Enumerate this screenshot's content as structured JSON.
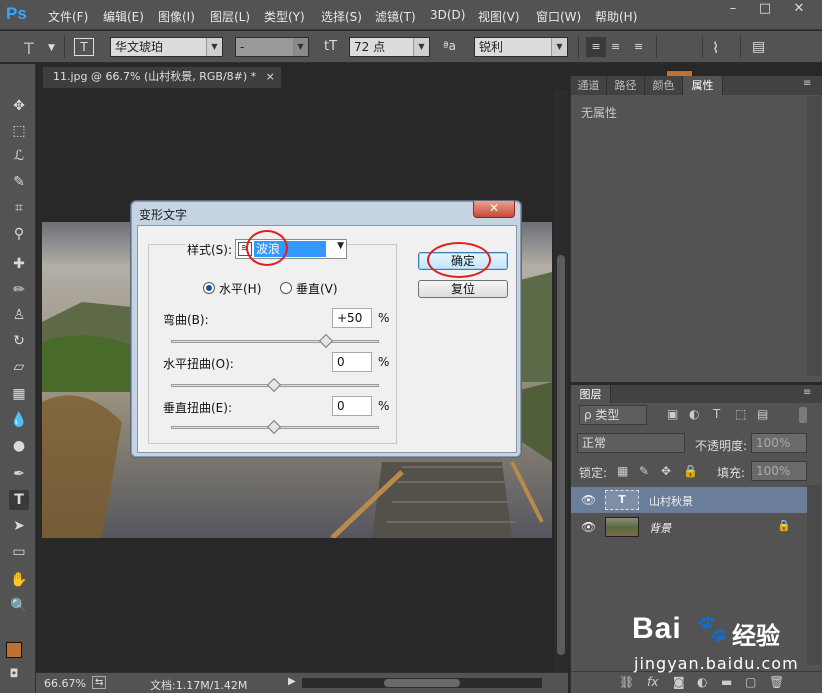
{
  "menubar": {
    "logo": "Ps",
    "items": [
      "文件(F)",
      "编辑(E)",
      "图像(I)",
      "图层(L)",
      "类型(Y)",
      "选择(S)",
      "滤镜(T)",
      "3D(D)",
      "视图(V)",
      "窗口(W)",
      "帮助(H)"
    ],
    "controls": [
      "–",
      "□",
      "✕"
    ]
  },
  "options": {
    "font_family": "华文琥珀",
    "font_style": "-",
    "font_size": "72 点",
    "aa_label": "a",
    "aa_mode": "锐利",
    "text_color": "#c07030"
  },
  "document": {
    "tab_title": "11.jpg @ 66.7% (山村秋景, RGB/8#) *",
    "tab_close": "×"
  },
  "status": {
    "zoom": "66.67%",
    "doc_info": "文档:1.17M/1.42M"
  },
  "props_panel": {
    "tabs": [
      "通道",
      "路径",
      "颜色",
      "属性"
    ],
    "active_tab": 3,
    "content": "无属性"
  },
  "layers_panel": {
    "title": "图层",
    "filter_label": "ρ 类型",
    "blend_mode": "正常",
    "opacity_label": "不透明度:",
    "opacity_value": "100%",
    "lock_label": "锁定:",
    "fill_label": "填充:",
    "fill_value": "100%",
    "layers": [
      {
        "name": "山村秋景",
        "thumb": "T",
        "selected": true
      },
      {
        "name": "背景",
        "thumb": "",
        "selected": false
      }
    ]
  },
  "dialog": {
    "title": "变形文字",
    "style_label": "样式(S):",
    "style_value": "波浪",
    "horizontal_label": "水平(H)",
    "vertical_label": "垂直(V)",
    "bend_label": "弯曲(B):",
    "bend_value": "+50",
    "h_distort_label": "水平扭曲(O):",
    "h_distort_value": "0",
    "v_distort_label": "垂直扭曲(E):",
    "v_distort_value": "0",
    "percent": "%",
    "ok_label": "确定",
    "reset_label": "复位",
    "bend_level": 0.75,
    "h_distort_level": 0.5,
    "v_distort_level": 0.5
  },
  "watermark": {
    "brand": "Bai",
    "brand2": "经验",
    "url": "jingyan.baidu.com"
  }
}
